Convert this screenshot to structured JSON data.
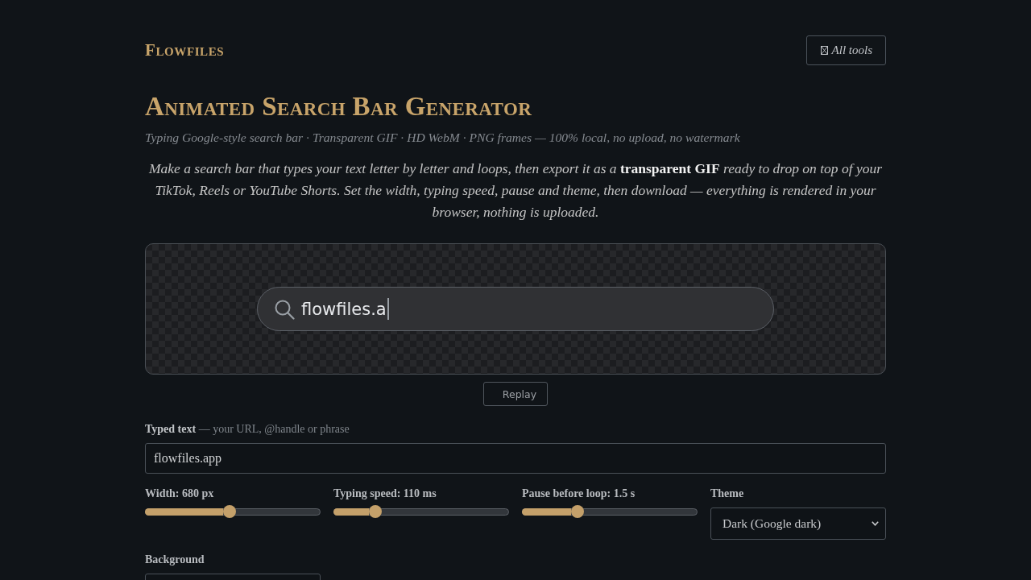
{
  "header": {
    "logo": "Flowfiles",
    "all_tools_button": "All tools"
  },
  "title": "Animated Search Bar Generator",
  "subtitle": "Typing Google-style search bar · Transparent GIF · HD WebM · PNG frames — 100% local, no upload, no watermark",
  "intro": "Make a search bar that types your text letter by letter and loops, then export it as a **transparent GIF** ready to drop on top of your TikTok, Reels or YouTube Shorts. Set the width, typing speed, pause and theme, then download — everything is rendered in your browser, nothing is uploaded.",
  "preview": {
    "search_text": "flowfiles.a",
    "replay_button": "Replay"
  },
  "typed_text": {
    "label": "**Typed text** — your URL, @handle or phrase",
    "value": "flowfiles.app"
  },
  "settings": [
    {
      "kind": "slider",
      "label": "Width: 680 px",
      "level": 0.48
    },
    {
      "kind": "slider",
      "label": "Typing speed: 110 ms",
      "level": 0.22
    },
    {
      "kind": "slider",
      "label": "Pause before loop: 1.5 s",
      "level": 0.3
    },
    {
      "kind": "select",
      "label": "Theme",
      "value": "Dark (Google dark)"
    },
    {
      "kind": "select",
      "label": "Background"
    }
  ]
}
